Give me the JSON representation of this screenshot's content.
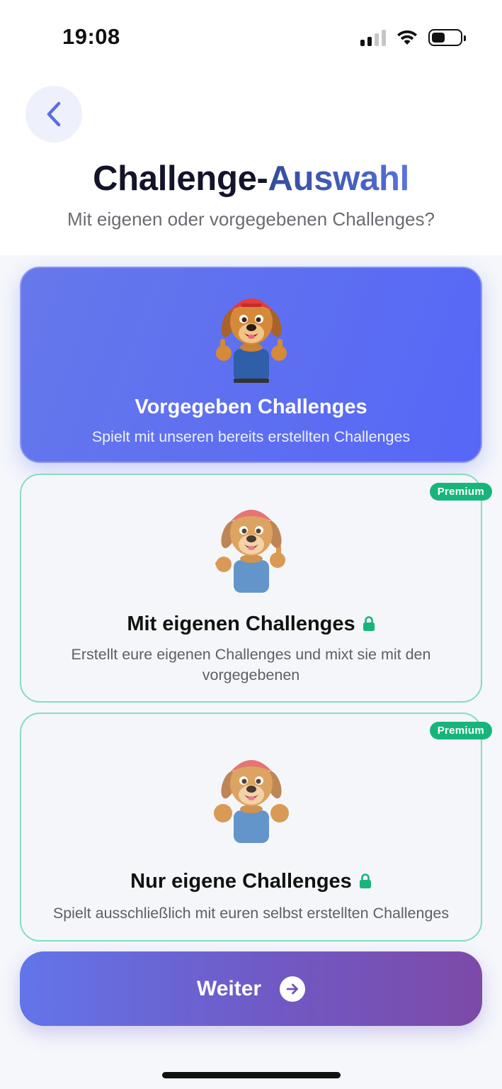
{
  "status_bar": {
    "time": "19:08",
    "icons": [
      "signal-icon",
      "wifi-icon",
      "battery-icon"
    ]
  },
  "header": {
    "back_icon": "chevron-left-icon",
    "title_part1": "Challenge-",
    "title_part2": "Auswahl",
    "subtitle": "Mit eigenen oder vorgegebenen Challenges?"
  },
  "options": [
    {
      "title": "Vorgegeben Challenges",
      "description": "Spielt mit unseren bereits erstellten Challenges",
      "selected": true,
      "locked": false,
      "mascot": "dog-thumbs-up"
    },
    {
      "title": "Mit eigenen Challenges",
      "description": "Erstellt eure eigenen Challenges und mixt sie mit den vorgegebenen",
      "badge": "Premium",
      "selected": false,
      "locked": true,
      "mascot": "dog-pointing"
    },
    {
      "title": "Nur eigene Challenges",
      "description": "Spielt ausschließlich mit euren selbst erstellten Challenges",
      "badge": "Premium",
      "selected": false,
      "locked": true,
      "mascot": "dog-pointing-both"
    }
  ],
  "continue_button": {
    "label": "Weiter",
    "icon": "arrow-right-icon"
  },
  "colors": {
    "accent": "#5667f7",
    "premium": "#17b57c",
    "locked_border": "#87dcbf"
  }
}
